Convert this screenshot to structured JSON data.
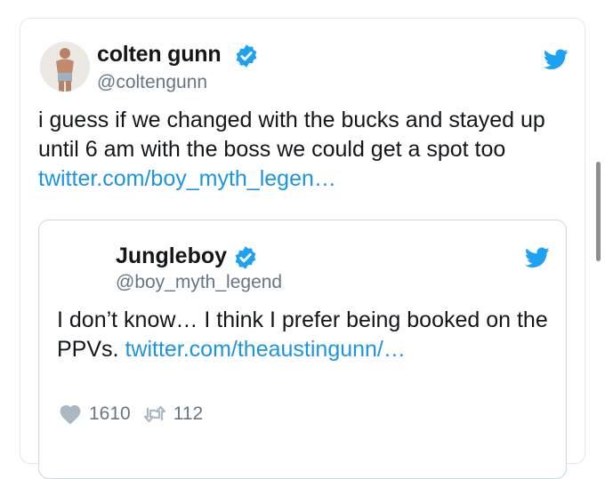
{
  "tweet": {
    "author_name": "colten gunn",
    "author_handle": "@coltengunn",
    "text": "i guess if we changed with the bucks and stayed up until 6 am with the boss we could get a spot too",
    "link": "twitter.com/boy_myth_legen…",
    "icons": {
      "verified": "verified-badge-icon",
      "brand": "twitter-bird-icon"
    },
    "colors": {
      "link": "#1b95e0",
      "verified": "#1da1f2",
      "handle": "#657786"
    }
  },
  "quoted_tweet": {
    "author_name": "Jungleboy",
    "author_handle": "@boy_myth_legend",
    "text": "I don’t know… I think I prefer being booked on the PPVs.",
    "link": "twitter.com/theaustingunn/…",
    "likes": "1610",
    "retweets": "112",
    "icons": {
      "like": "heart-icon",
      "retweet": "retweet-icon",
      "brand": "twitter-bird-icon"
    }
  }
}
